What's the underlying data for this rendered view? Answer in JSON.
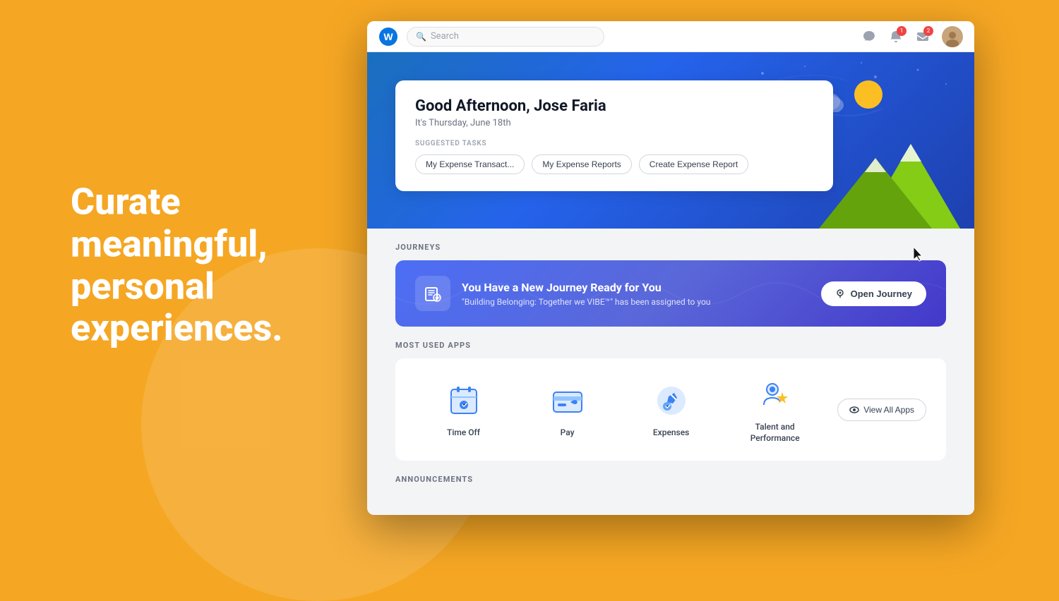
{
  "background": {
    "color": "#F5A623"
  },
  "hero_text": {
    "line1": "Curate",
    "line2": "meaningful,",
    "line3": "personal",
    "line4": "experiences."
  },
  "browser": {
    "logo_alt": "Workday W logo",
    "search_placeholder": "Search",
    "nav_icons": [
      "chat",
      "bell",
      "inbox",
      "avatar"
    ],
    "bell_badge": "1",
    "inbox_badge": "2"
  },
  "welcome_card": {
    "greeting": "Good Afternoon, Jose Faria",
    "date": "It's Thursday, June 18th",
    "suggested_tasks_label": "SUGGESTED TASKS",
    "tasks": [
      "My Expense Transact...",
      "My Expense Reports",
      "Create Expense Report"
    ]
  },
  "journeys_section": {
    "label": "JOURNEYS",
    "banner": {
      "title": "You Have a New Journey Ready for You",
      "subtitle": "\"Building Belonging: Together we VIBE™\" has been assigned to you",
      "button_label": "Open Journey"
    }
  },
  "apps_section": {
    "label": "MOST USED APPS",
    "apps": [
      {
        "name": "Time Off",
        "icon": "time-off"
      },
      {
        "name": "Pay",
        "icon": "pay"
      },
      {
        "name": "Expenses",
        "icon": "expenses"
      },
      {
        "name": "Talent and\nPerformance",
        "icon": "talent"
      }
    ],
    "view_all_label": "View All Apps"
  },
  "announcements_section": {
    "label": "ANNOUNCEMENTS"
  }
}
